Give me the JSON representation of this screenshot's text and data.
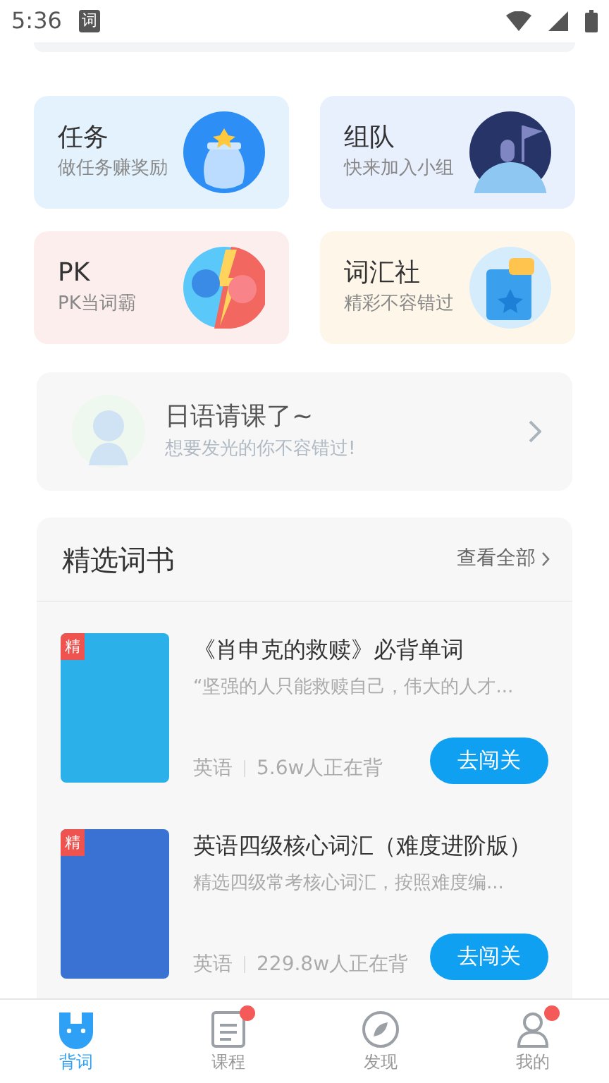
{
  "status_bar": {
    "time": "5:36",
    "app_badge": "词"
  },
  "features": [
    {
      "kind": "task",
      "title": "任务",
      "subtitle": "做任务赚奖励",
      "color": "#e3f2fd"
    },
    {
      "kind": "team",
      "title": "组队",
      "subtitle": "快来加入小组",
      "color": "#e8effd"
    },
    {
      "kind": "pk",
      "title": "PK",
      "subtitle": "PK当词霸",
      "color": "#fdeeee"
    },
    {
      "kind": "club",
      "title": "词汇社",
      "subtitle": "精彩不容错过",
      "color": "#fdf6e9"
    }
  ],
  "promo": {
    "title": "日语请课了~",
    "subtitle": "想要发光的你不容错过!"
  },
  "books_section": {
    "title": "精选词书",
    "more": "查看全部",
    "books": [
      {
        "color": "#2bb0ea",
        "badge": "精",
        "title": "《肖申克的救赎》必背单词",
        "description": "“坚强的人只能救赎自己，伟大的人才...",
        "language": "英语",
        "learners": "5.6w人正在背",
        "action": "去闯关"
      },
      {
        "color": "#3a72d4",
        "badge": "精",
        "title": "英语四级核心词汇（难度进阶版）",
        "description": "精选四级常考核心词汇，按照难度编...",
        "language": "英语",
        "learners": "229.8w人正在背",
        "action": "去闯关"
      }
    ]
  },
  "nav": [
    {
      "kind": "words",
      "label": "背词",
      "selected": true,
      "badge": false
    },
    {
      "kind": "courses",
      "label": "课程",
      "selected": false,
      "badge": true
    },
    {
      "kind": "discover",
      "label": "发现",
      "selected": false,
      "badge": false
    },
    {
      "kind": "me",
      "label": "我的",
      "selected": false,
      "badge": true
    }
  ]
}
